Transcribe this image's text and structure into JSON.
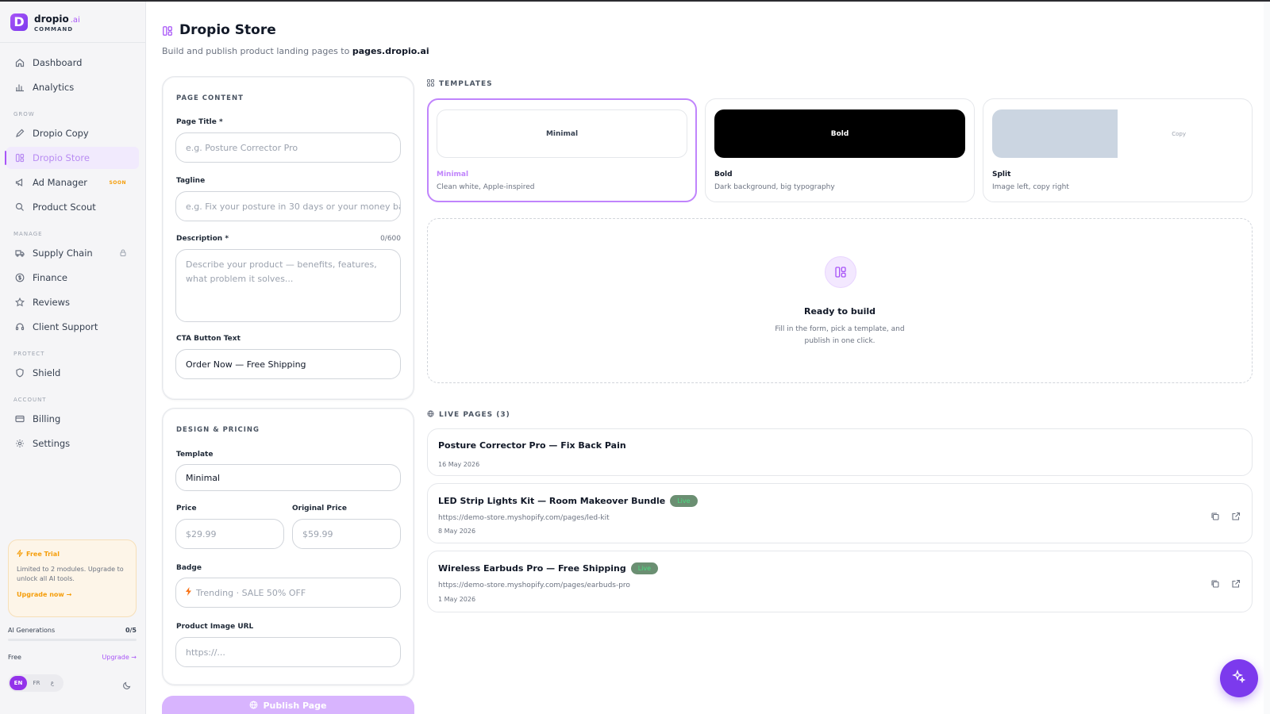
{
  "brand": {
    "name": "dropio",
    "suffix": ".ai",
    "sub": "COMMAND"
  },
  "nav": {
    "dashboard": "Dashboard",
    "analytics": "Analytics",
    "grow_label": "GROW",
    "copy": "Dropio Copy",
    "store": "Dropio Store",
    "ads": "Ad Manager",
    "ads_badge": "SOON",
    "scout": "Product Scout",
    "manage_label": "MANAGE",
    "supply": "Supply Chain",
    "finance": "Finance",
    "reviews": "Reviews",
    "support": "Client Support",
    "protect_label": "PROTECT",
    "shield": "Shield",
    "account_label": "ACCOUNT",
    "billing": "Billing",
    "settings": "Settings"
  },
  "trial": {
    "title": "Free Trial",
    "text": "Limited to 2 modules. Upgrade to unlock all AI tools.",
    "link": "Upgrade now →"
  },
  "usage": {
    "label": "AI Generations",
    "value": "0/5",
    "used_fraction": 0
  },
  "plan": {
    "name": "Free",
    "upgrade": "Upgrade →"
  },
  "lang": {
    "en": "EN",
    "fr": "FR",
    "third": "ع"
  },
  "header": {
    "title": "Dropio Store",
    "subtitle_prefix": "Build and publish product landing pages to ",
    "subtitle_domain": "pages.dropio.ai"
  },
  "content": {
    "section": "PAGE CONTENT",
    "title_label": "Page Title *",
    "title_placeholder": "e.g. Posture Corrector Pro",
    "tagline_label": "Tagline",
    "tagline_placeholder": "e.g. Fix your posture in 30 days or your money back",
    "desc_label": "Description *",
    "desc_counter": "0/600",
    "desc_placeholder": "Describe your product — benefits, features, what problem it solves...",
    "cta_label": "CTA Button Text",
    "cta_value": "Order Now — Free Shipping"
  },
  "design": {
    "section": "DESIGN & PRICING",
    "template_label": "Template",
    "template_value": "Minimal",
    "price_label": "Price",
    "price_placeholder": "$29.99",
    "orig_label": "Original Price",
    "orig_placeholder": "$59.99",
    "badge_label": "Badge",
    "badge_placeholder": "Trending · SALE 50% OFF",
    "image_label": "Product Image URL",
    "image_placeholder": "https://..."
  },
  "publish": "Publish Page",
  "templates": {
    "section": "TEMPLATES",
    "items": [
      {
        "preview": "Minimal",
        "name": "Minimal",
        "desc": "Clean white, Apple-inspired"
      },
      {
        "preview": "Bold",
        "name": "Bold",
        "desc": "Dark background, big typography"
      },
      {
        "preview": "Copy",
        "name": "Split",
        "desc": "Image left, copy right"
      }
    ]
  },
  "empty": {
    "title": "Ready to build",
    "line1": "Fill in the form, pick a template, and",
    "line2": "publish in one click."
  },
  "live": {
    "section": "LIVE PAGES (3)",
    "pages": [
      {
        "title": "Posture Corrector Pro — Fix Back Pain",
        "date": "16 May 2026"
      },
      {
        "title": "LED Strip Lights Kit — Room Makeover Bundle",
        "badge": "Live",
        "url": "https://demo-store.myshopify.com/pages/led-kit",
        "date": "8 May 2026"
      },
      {
        "title": "Wireless Earbuds Pro — Free Shipping",
        "badge": "Live",
        "url": "https://demo-store.myshopify.com/pages/earbuds-pro",
        "date": "1 May 2026"
      }
    ]
  },
  "colors": {
    "accent": "#a855f7",
    "fab": "#7c3aed",
    "warning": "#f59e0b",
    "live": "#4ade80"
  }
}
